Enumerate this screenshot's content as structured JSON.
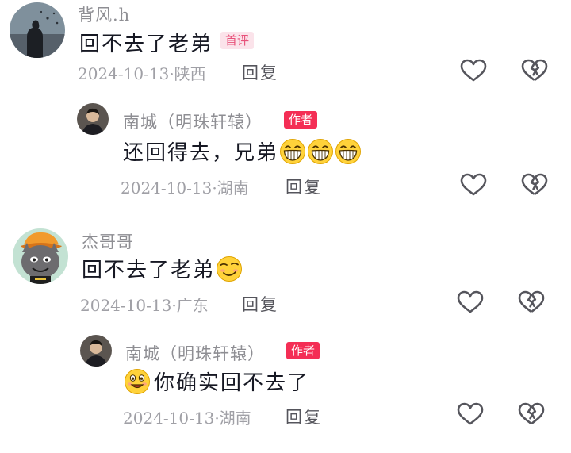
{
  "comments": [
    {
      "username": "背风.h",
      "badge": "首评",
      "text": "回不去了老弟",
      "date": "2024-10-13",
      "location": "陕西",
      "reply_label": "回复",
      "icons": [
        "heart-icon",
        "dislike-broken-heart-icon"
      ]
    },
    {
      "username": "南城（明珠轩辕）",
      "badge": "作者",
      "text": "还回得去，兄弟",
      "emojis": [
        "grin-emoji",
        "grin-emoji",
        "grin-emoji"
      ],
      "date": "2024-10-13",
      "location": "湖南",
      "reply_label": "回复"
    },
    {
      "username": "杰哥哥",
      "text": "回不去了老弟",
      "emojis": [
        "smug-smile-emoji"
      ],
      "date": "2024-10-13",
      "location": "广东",
      "reply_label": "回复"
    },
    {
      "username": "南城（明珠轩辕）",
      "badge": "作者",
      "leading_emoji": "proud-smile-emoji",
      "text": "你确实回不去了",
      "date": "2024-10-13",
      "location": "湖南",
      "reply_label": "回复"
    }
  ],
  "separator": "·",
  "colors": {
    "author_badge_bg": "#f42e55",
    "first_badge_bg": "#fbe3ea",
    "first_badge_text": "#e8517a",
    "meta_text": "#a0a0a6"
  }
}
